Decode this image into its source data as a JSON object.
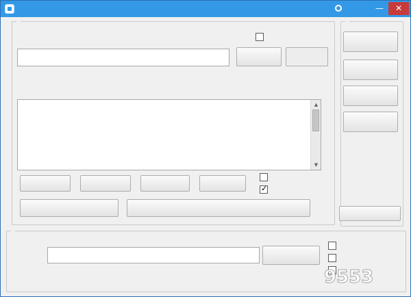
{
  "window": {
    "title": "",
    "icons": {
      "app": "app-icon",
      "skin": "skin-icon",
      "minimize": "minimize-icon",
      "close": "close-icon"
    },
    "titlebar_color": "#3399e6",
    "close_color": "#c73b3b",
    "minimize_glyph": "—",
    "close_glyph": "✕"
  },
  "site_group": {
    "legend": "",
    "instruction": "",
    "url_input": {
      "value": "",
      "placeholder": ""
    },
    "parse_button": "",
    "mode2_checkbox": {
      "label": "",
      "checked": false
    },
    "mode2_button": "",
    "log_lines": [
      "",
      "",
      "",
      "",
      "",
      "",
      "",
      "",
      "",
      "",
      "",
      ""
    ],
    "buttons": {
      "watch_online": "",
      "online_parse": "",
      "supported_sites": "",
      "download": "",
      "block_ads": "",
      "download_plugin": ""
    },
    "checkboxes": {
      "pc_download": {
        "label": "",
        "checked": false
      },
      "built_in_downloader": {
        "label": "",
        "checked": true
      }
    }
  },
  "vip_group": {
    "legend": "",
    "buttons": [
      "",
      "",
      "",
      ""
    ],
    "notice": "",
    "notice_color": "#d40000",
    "more_resources": ""
  },
  "online_group": {
    "legend": "",
    "address_label": "",
    "address_value": "",
    "watch_button": "",
    "interfaces": [
      {
        "label": "",
        "checked": false
      },
      {
        "label": "",
        "checked": false
      },
      {
        "label": "",
        "checked": false
      }
    ],
    "footer": ""
  },
  "watermark": {
    "text": ""
  }
}
